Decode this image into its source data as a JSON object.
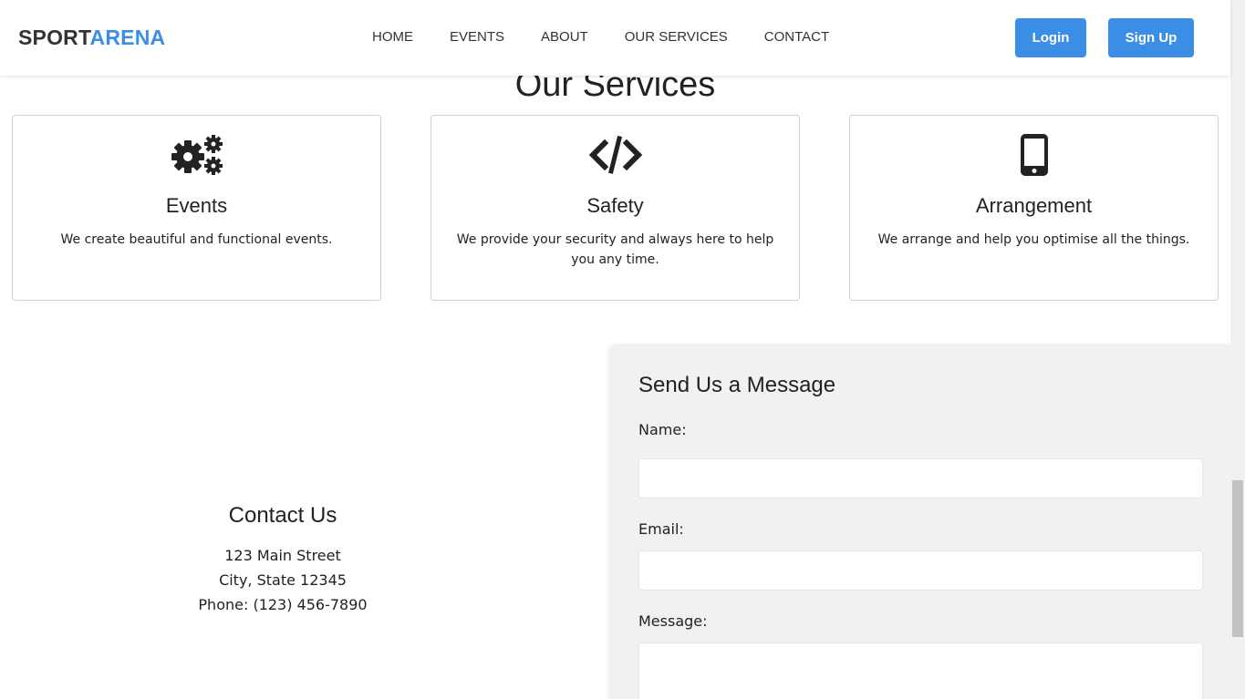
{
  "header": {
    "logo_part1": "SPORT",
    "logo_part2": "ARENA",
    "nav": [
      "HOME",
      "EVENTS",
      "ABOUT",
      "OUR SERVICES",
      "CONTACT"
    ],
    "login_label": "Login",
    "signup_label": "Sign Up"
  },
  "services": {
    "title": "Our Services",
    "cards": [
      {
        "icon": "gears-icon",
        "title": "Events",
        "description": "We create beautiful and functional events."
      },
      {
        "icon": "code-icon",
        "title": "Safety",
        "description": "We provide your security and always here to help you any time."
      },
      {
        "icon": "mobile-phone-icon",
        "title": "Arrangement",
        "description": "We arrange and help you optimise all the things."
      }
    ]
  },
  "contact": {
    "title": "Contact Us",
    "address_line1": "123 Main Street",
    "address_line2": "City, State 12345",
    "phone": "Phone: (123) 456-7890"
  },
  "form": {
    "title": "Send Us a Message",
    "name_label": "Name:",
    "name_value": "",
    "email_label": "Email:",
    "email_value": "",
    "message_label": "Message:",
    "message_value": ""
  },
  "colors": {
    "accent": "#3a8ee6",
    "text": "#222222",
    "form_background": "#f1f1f1"
  }
}
